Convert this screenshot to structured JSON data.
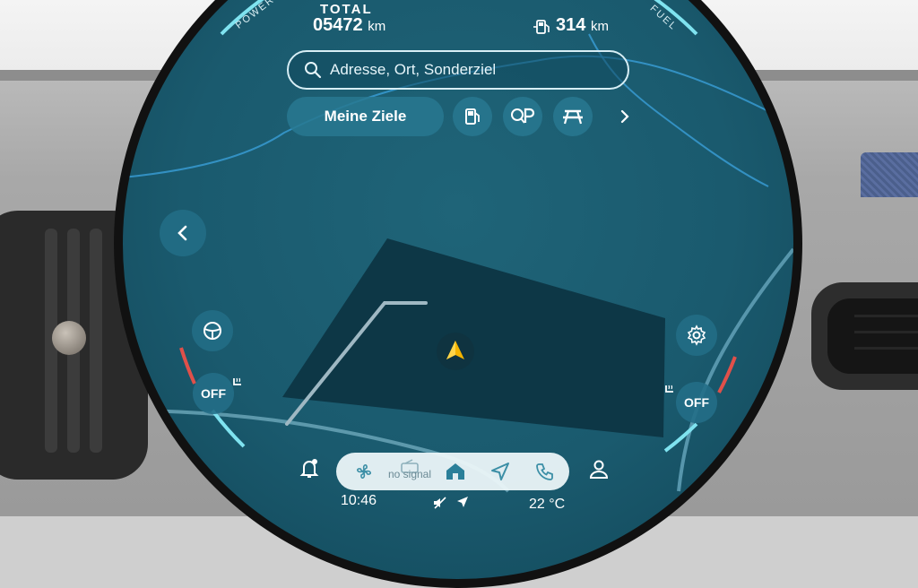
{
  "cluster": {
    "total_label": "TOTAL",
    "odometer_value": "05472",
    "odometer_unit": "km",
    "range_value": "314",
    "range_unit": "km",
    "power_label": "POWER",
    "fuel_label": "FUEL"
  },
  "search": {
    "placeholder": "Adresse, Ort, Sonderziel",
    "icon": "search-icon"
  },
  "nav_row": {
    "my_destinations_label": "Meine Ziele",
    "icons": [
      "fuel-station-icon",
      "parking-search-icon",
      "picnic-rest-area-icon",
      "chevron-right-icon"
    ]
  },
  "side_controls": {
    "back_icon": "chevron-left-icon",
    "steering_wheel_icon": "steering-wheel-heating-icon",
    "settings_icon": "gear-icon",
    "seat_heat_left_label": "OFF",
    "seat_heat_right_label": "OFF"
  },
  "dock": {
    "items": [
      "fan-icon",
      "radio-icon",
      "home-icon",
      "navigation-arrow-icon",
      "phone-icon"
    ],
    "radio_status": "no signal",
    "left_icon": "notification-bell-icon",
    "right_icon": "user-profile-icon"
  },
  "status_bar": {
    "time": "10:46",
    "temperature": "22 °C",
    "icons": [
      "mute-icon",
      "location-arrow-icon"
    ]
  },
  "colors": {
    "screen_blue": "#1a5a6e",
    "panel_blue": "#287891",
    "accent_cyan": "#7fe3f0",
    "accent_red": "#e0504a",
    "position_marker": "#f4b400"
  }
}
